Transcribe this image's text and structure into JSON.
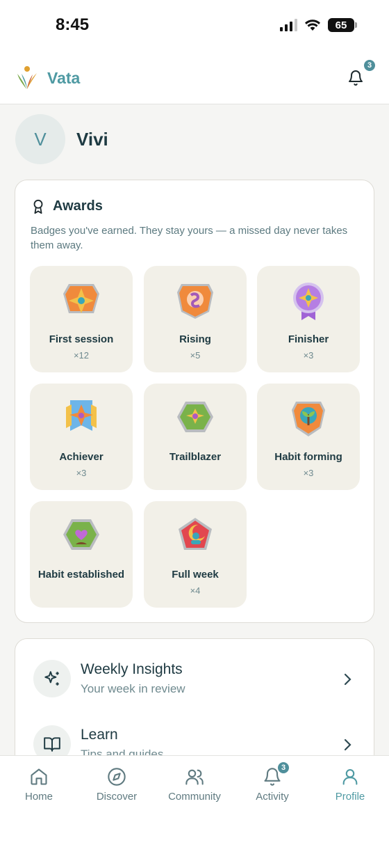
{
  "status_bar": {
    "time": "8:45",
    "battery": "65"
  },
  "header": {
    "app_name": "Vata",
    "notification_count": "3"
  },
  "profile": {
    "avatar_initial": "V",
    "name": "Vivi"
  },
  "awards": {
    "title": "Awards",
    "description": "Badges you've earned. They stay yours — a missed day never takes them away.",
    "badges": [
      {
        "name": "First session",
        "count": "×12",
        "icon": "star-shield-badge-icon"
      },
      {
        "name": "Rising",
        "count": "×5",
        "icon": "sunrise-shield-badge-icon"
      },
      {
        "name": "Finisher",
        "count": "×3",
        "icon": "ribbon-medal-badge-icon"
      },
      {
        "name": "Achiever",
        "count": "×3",
        "icon": "star-banner-badge-icon"
      },
      {
        "name": "Trailblazer",
        "count": "",
        "icon": "hexagon-star-badge-icon"
      },
      {
        "name": "Habit forming",
        "count": "×3",
        "icon": "sprout-shield-badge-icon"
      },
      {
        "name": "Habit established",
        "count": "",
        "icon": "heart-plant-badge-icon"
      },
      {
        "name": "Full week",
        "count": "×4",
        "icon": "moon-pentagon-badge-icon"
      }
    ]
  },
  "menu": [
    {
      "title": "Weekly Insights",
      "subtitle": "Your week in review",
      "icon": "sparkles-icon"
    },
    {
      "title": "Learn",
      "subtitle": "Tips and guides",
      "icon": "open-book-icon"
    }
  ],
  "bottom_nav": {
    "items": [
      {
        "label": "Home",
        "icon": "home-icon"
      },
      {
        "label": "Discover",
        "icon": "compass-icon"
      },
      {
        "label": "Community",
        "icon": "users-icon"
      },
      {
        "label": "Activity",
        "icon": "bell-icon",
        "badge": "3"
      },
      {
        "label": "Profile",
        "icon": "profile-icon"
      }
    ],
    "active": "Profile"
  },
  "colors": {
    "accent": "#4f9aa3",
    "tile_bg": "#f2f0e8",
    "text_dark": "#1e3a42"
  }
}
